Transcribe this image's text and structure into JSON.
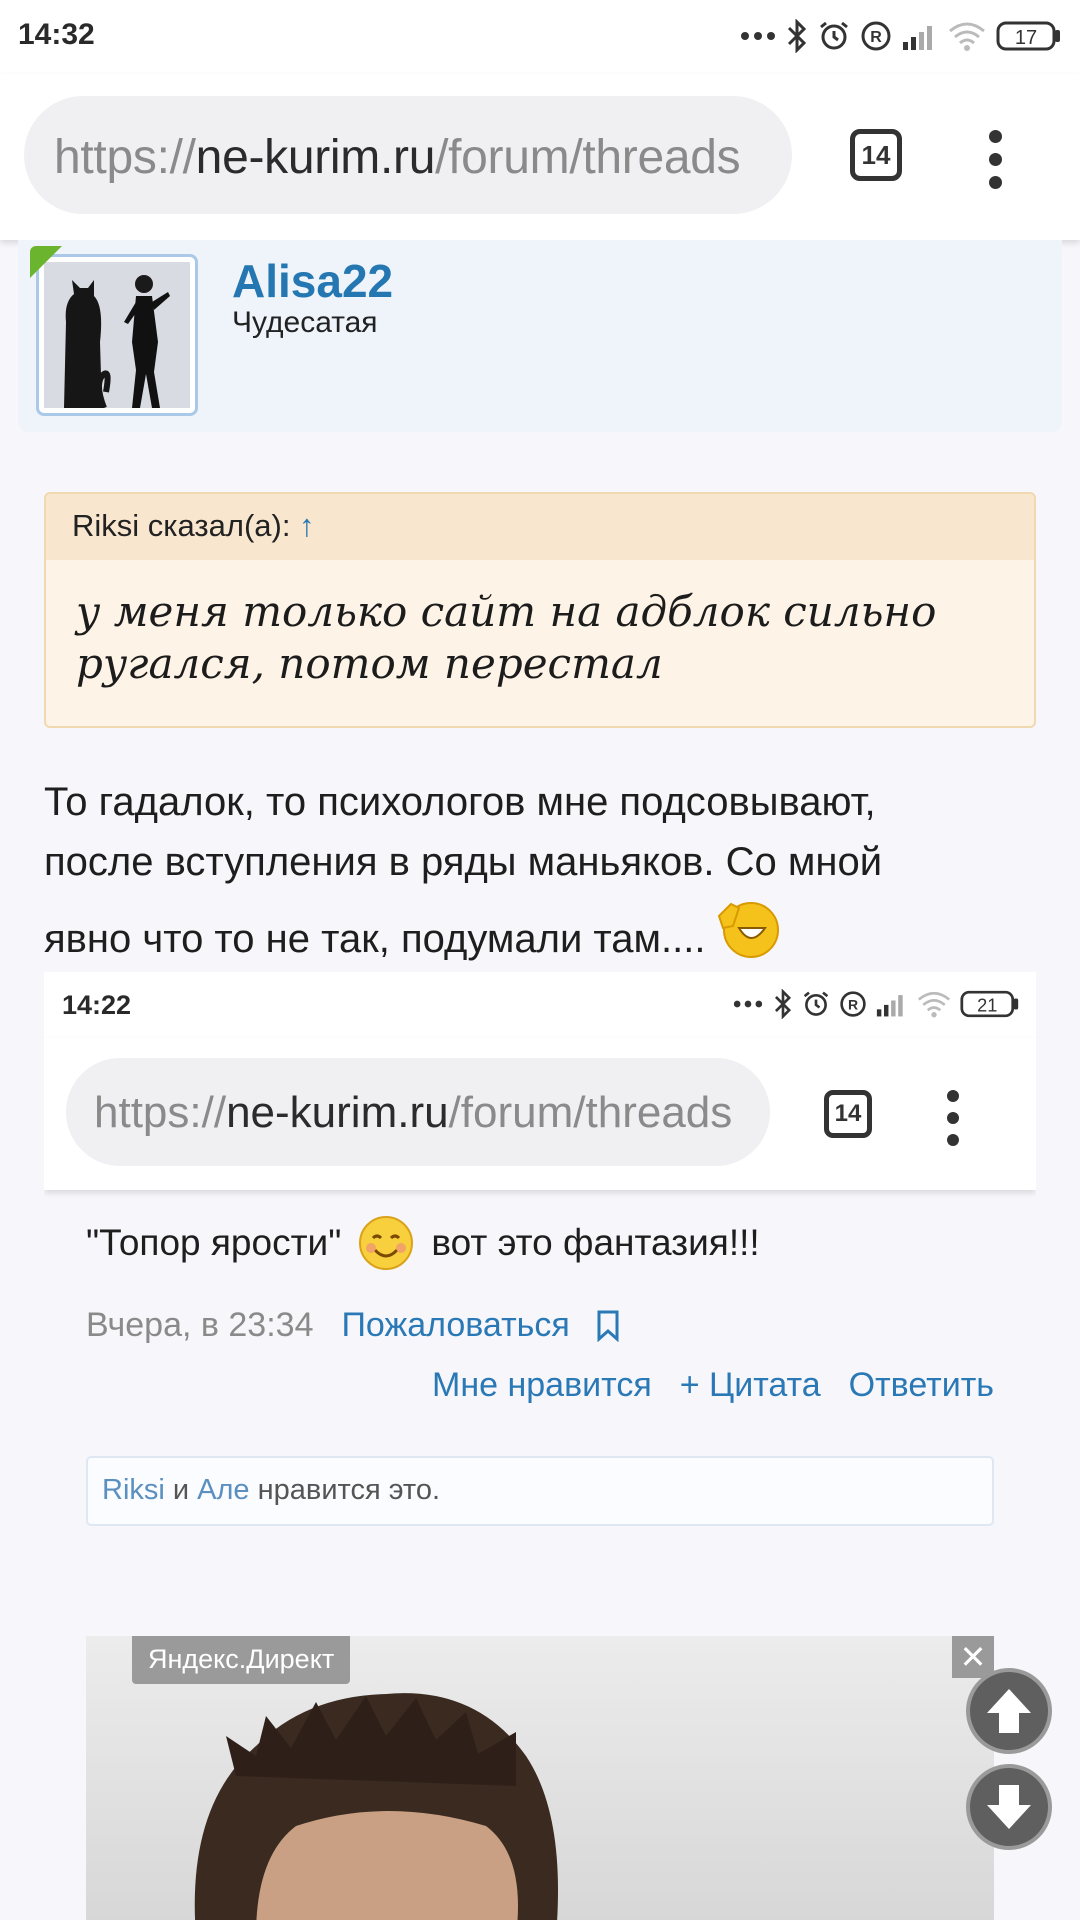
{
  "status_bar": {
    "time": "14:32",
    "battery": "17"
  },
  "browser": {
    "url_scheme": "https://",
    "url_host": "ne-kurim.ru",
    "url_path": "/forum/threads",
    "tab_count": "14"
  },
  "user": {
    "name": "Alisa22",
    "title": "Чудесатая"
  },
  "quote": {
    "author": "Riksi сказал(а):",
    "arrow": "↑",
    "text": "у меня только сайт на адблок сильно ругался, потом перестал"
  },
  "post": {
    "line1": "То гадалок, то психологов мне подсовывают,",
    "line2": "после вступления в ряды маньяков. Со мной",
    "line3": "явно что то не так, подумали там...."
  },
  "screenshot": {
    "status_time": "14:22",
    "battery": "21",
    "url_scheme": "https://",
    "url_host": "ne-kurim.ru",
    "url_path": "/forum/threads",
    "tab_count": "14",
    "quote_text": "\"Топор ярости\"",
    "after_text": "вот это фантазия!!!",
    "timestamp": "Вчера, в 23:34",
    "report": "Пожаловаться",
    "actions": {
      "like": "Мне нравится",
      "quote": "+ Цитата",
      "reply": "Ответить"
    },
    "likes": {
      "user1": "Riksi",
      "and": "и",
      "user2": "Але",
      "suffix": "нравится это."
    },
    "ad_label": "Яндекс.Директ",
    "ad_close": "✕"
  },
  "colors": {
    "accent": "#2577b1",
    "link": "#2a79b6",
    "quote_bg": "#fdf3e6",
    "badge": "#6ab42e"
  },
  "icons": [
    "bluetooth-icon",
    "alarm-icon",
    "registered-icon",
    "signal-icon",
    "wifi-icon",
    "battery-icon",
    "menu-dots-icon",
    "bookmark-icon",
    "scroll-up-icon",
    "scroll-down-icon"
  ]
}
